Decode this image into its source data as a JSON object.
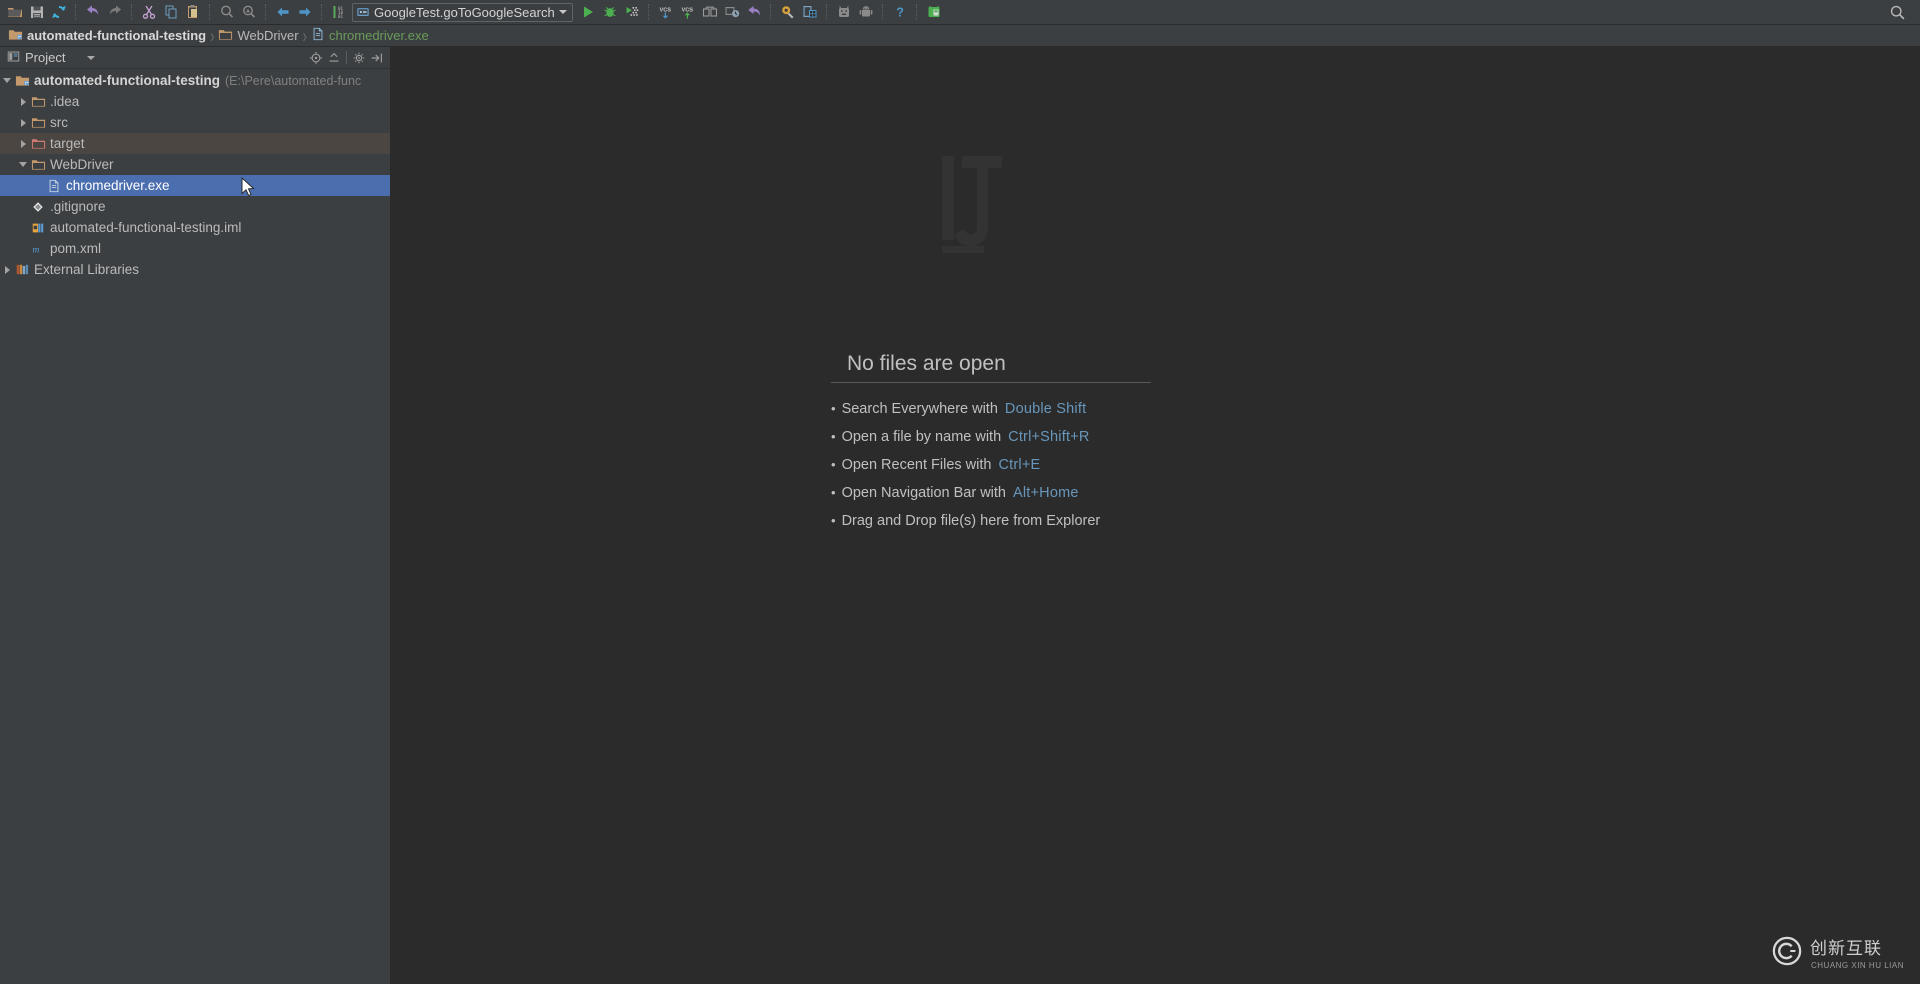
{
  "toolbar": {
    "buttons": [
      {
        "name": "open-folder-icon",
        "label": "Open"
      },
      {
        "name": "save-all-icon",
        "label": "Save All"
      },
      {
        "name": "sync-refresh-icon",
        "label": "Synchronize"
      },
      {
        "name": "undo-icon",
        "label": "Undo"
      },
      {
        "name": "redo-icon",
        "label": "Redo"
      },
      {
        "name": "cut-icon",
        "label": "Cut"
      },
      {
        "name": "copy-icon",
        "label": "Copy"
      },
      {
        "name": "paste-icon",
        "label": "Paste"
      },
      {
        "name": "find-icon",
        "label": "Find"
      },
      {
        "name": "replace-icon",
        "label": "Replace"
      },
      {
        "name": "back-icon",
        "label": "Back"
      },
      {
        "name": "forward-icon",
        "label": "Forward"
      },
      {
        "name": "compile-icon",
        "label": "Compile"
      },
      {
        "name": "run-icon",
        "label": "Run"
      },
      {
        "name": "debug-icon",
        "label": "Debug"
      },
      {
        "name": "run-with-coverage-icon",
        "label": "Run with Coverage"
      },
      {
        "name": "vcs-update-icon",
        "label": "Update Project"
      },
      {
        "name": "vcs-commit-icon",
        "label": "Commit"
      },
      {
        "name": "diff-icon",
        "label": "Compare"
      },
      {
        "name": "history-icon",
        "label": "Show History"
      },
      {
        "name": "revert-icon",
        "label": "Revert"
      },
      {
        "name": "settings-icon",
        "label": "Settings"
      },
      {
        "name": "project-structure-icon",
        "label": "Project Structure"
      },
      {
        "name": "sdk-manager-icon",
        "label": "SDK Manager"
      },
      {
        "name": "avd-manager-icon",
        "label": "AVD Manager"
      },
      {
        "name": "help-icon",
        "label": "Help"
      },
      {
        "name": "android-device-icon",
        "label": "Device Manager"
      }
    ],
    "run_config": {
      "label": "GoogleTest.goToGoogleSearch",
      "icon": "run-configuration-icon"
    },
    "search_icon": "search-everywhere-icon"
  },
  "breadcrumb": {
    "items": [
      {
        "label": "automated-functional-testing",
        "icon": "project-folder-icon",
        "kind": "root"
      },
      {
        "label": "WebDriver",
        "icon": "folder-icon",
        "kind": "mid"
      },
      {
        "label": "chromedriver.exe",
        "icon": "file-icon",
        "kind": "leaf"
      }
    ],
    "separator": "›"
  },
  "project_panel": {
    "title": "Project",
    "header_icon": "project-view-icon",
    "dropdown_icon": "chevron-down-icon",
    "actions": [
      {
        "name": "locate-icon",
        "label": "Select Opened File"
      },
      {
        "name": "collapse-all-icon",
        "label": "Collapse All"
      },
      {
        "name": "settings-gear-icon",
        "label": "Settings"
      },
      {
        "name": "hide-panel-icon",
        "label": "Hide"
      }
    ],
    "tree": [
      {
        "label": "automated-functional-testing",
        "path": "(E:\\Pere\\automated-func",
        "icon": "project-folder-icon",
        "arrow": "down",
        "indent": 0,
        "style": "bold",
        "state": "normal"
      },
      {
        "label": ".idea",
        "icon": "folder-icon",
        "arrow": "right",
        "indent": 1,
        "style": "plain",
        "state": "normal"
      },
      {
        "label": "src",
        "icon": "folder-icon",
        "arrow": "right",
        "indent": 1,
        "style": "plain",
        "state": "normal"
      },
      {
        "label": "target",
        "icon": "folder-excluded-icon",
        "arrow": "right",
        "indent": 1,
        "style": "plain",
        "state": "hover"
      },
      {
        "label": "WebDriver",
        "icon": "folder-icon",
        "arrow": "down",
        "indent": 1,
        "style": "plain",
        "state": "normal"
      },
      {
        "label": "chromedriver.exe",
        "icon": "file-icon",
        "arrow": "none",
        "indent": 2,
        "style": "sel",
        "state": "selected"
      },
      {
        "label": ".gitignore",
        "icon": "gitignore-icon",
        "arrow": "none",
        "indent": 1,
        "style": "plain",
        "state": "normal"
      },
      {
        "label": "automated-functional-testing.iml",
        "icon": "iml-module-icon",
        "arrow": "none",
        "indent": 1,
        "style": "plain",
        "state": "normal"
      },
      {
        "label": "pom.xml",
        "icon": "maven-pom-icon",
        "arrow": "none",
        "indent": 1,
        "style": "maven",
        "state": "normal"
      },
      {
        "label": "External Libraries",
        "icon": "libraries-icon",
        "arrow": "right",
        "indent": 0,
        "style": "plain",
        "state": "normal"
      }
    ]
  },
  "editor": {
    "empty_title": "No files are open",
    "watermark_icon": "intellij-idea-watermark",
    "tips": [
      {
        "bullet": "•",
        "text": "Search Everywhere with",
        "key": "Double Shift"
      },
      {
        "bullet": "•",
        "text": "Open a file by name with",
        "key": "Ctrl+Shift+R"
      },
      {
        "bullet": "•",
        "text": "Open Recent Files with",
        "key": "Ctrl+E"
      },
      {
        "bullet": "•",
        "text": "Open Navigation Bar with",
        "key": "Alt+Home"
      },
      {
        "bullet": "•",
        "text": "Drag and Drop file(s) here from Explorer",
        "key": ""
      }
    ]
  },
  "brand": {
    "logo_icon": "chuangxin-logo-icon",
    "name": "创新互联",
    "sub": "CHUANG XIN HU LIAN"
  },
  "colors": {
    "accent_selection": "#4b6eaf",
    "hover_row": "#4b4642",
    "panel_bg": "#3c3f41",
    "editor_bg": "#2b2b2b",
    "key_hint": "#6897bb",
    "leaf_crumb": "#6a9b5b"
  }
}
